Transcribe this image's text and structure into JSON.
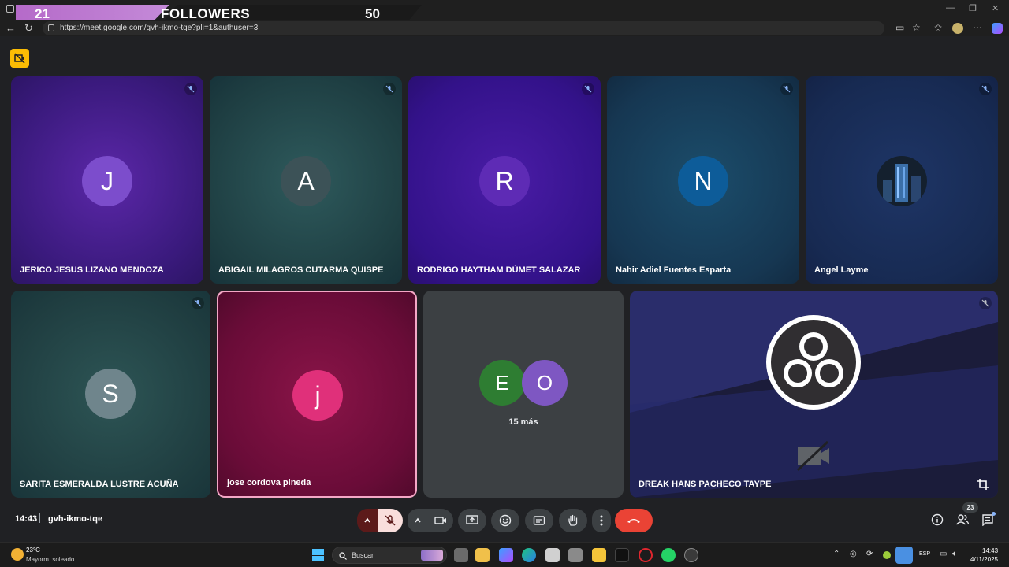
{
  "overlay": {
    "followers_current": "21",
    "followers_label": "FOLLOWERS",
    "followers_goal": "50"
  },
  "browser": {
    "url": "https://meet.google.com/gvh-ikmo-tqe?pli=1&authuser=3"
  },
  "tiles": [
    {
      "name": "JERICO JESUS LIZANO MENDOZA",
      "initial": "J",
      "avatar_color": "#7c4dcc"
    },
    {
      "name": "ABIGAIL MILAGROS CUTARMA QUISPE",
      "initial": "A",
      "avatar_color": "#3c5257"
    },
    {
      "name": "RODRIGO HAYTHAM DÚMET SALAZAR",
      "initial": "R",
      "avatar_color": "#5e2bb5"
    },
    {
      "name": "Nahir Adiel Fuentes Esparta",
      "initial": "N",
      "avatar_color": "#0d5c99"
    },
    {
      "name": "Angel Layme",
      "initial": "",
      "avatar_color": "#1b2b3d"
    },
    {
      "name": "SARITA ESMERALDA LUSTRE ACUÑA",
      "initial": "S",
      "avatar_color": "#6f858c"
    },
    {
      "name": "jose cordova pineda",
      "initial": "j",
      "avatar_color": "#e0307a"
    },
    {
      "name": "DREAK HANS PACHECO TAYPE",
      "initial": "",
      "avatar_color": "#000000"
    }
  ],
  "overflow": {
    "avatars": [
      {
        "initial": "E",
        "color": "#2e7d32"
      },
      {
        "initial": "O",
        "color": "#7e57c2"
      }
    ],
    "more_label": "15 más"
  },
  "bottom_bar": {
    "time": "14:43",
    "meeting_code": "gvh-ikmo-tqe",
    "participants_count": "23"
  },
  "taskbar": {
    "weather_temp": "23°C",
    "weather_desc": "Mayorm. soleado",
    "search_placeholder": "Buscar",
    "language": "ESP",
    "clock_time": "14:43",
    "clock_date": "4/11/2025"
  },
  "colors": {
    "leave_button": "#ea4335",
    "mic_off_active": "#f9dedc",
    "alert": "#fbbc04"
  }
}
